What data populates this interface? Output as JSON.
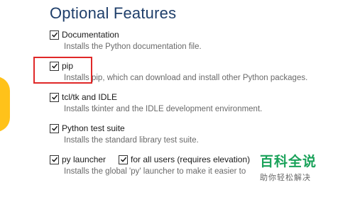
{
  "page": {
    "title": "Optional Features"
  },
  "features": [
    {
      "label": "Documentation",
      "description": "Installs the Python documentation file.",
      "checked": true
    },
    {
      "label": "pip",
      "description": "Installs pip, which can download and install other Python packages.",
      "checked": true
    },
    {
      "label": "tcl/tk and IDLE",
      "description": "Installs tkinter and the IDLE development environment.",
      "checked": true
    },
    {
      "label": "Python test suite",
      "description": "Installs the standard library test suite.",
      "checked": true
    },
    {
      "label": "py launcher",
      "description": "Installs the global 'py' launcher to make it easier to",
      "checked": true
    }
  ],
  "sub_option": {
    "label": "for all users (requires elevation)",
    "checked": true
  },
  "watermark": {
    "title": "百科全说",
    "subtitle": "助你轻松解决"
  },
  "colors": {
    "title": "#1e3e6a",
    "highlight": "#e02828",
    "accent_deco": "#ffc21a",
    "watermark": "#1aa25a"
  }
}
